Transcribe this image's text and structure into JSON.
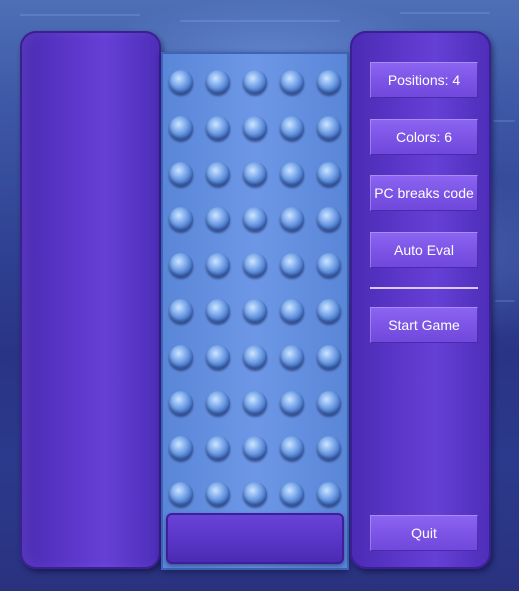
{
  "menu": {
    "positions_label": "Positions: 4",
    "colors_label": "Colors: 6",
    "mode_label": "PC breaks code",
    "auto_eval_label": "Auto Eval",
    "start_label": "Start Game",
    "quit_label": "Quit"
  },
  "board": {
    "rows": 10,
    "columns": 5
  },
  "colors": {
    "panel": "#5e38cc",
    "board": "#6d97e6",
    "button": "#7c55e6"
  }
}
